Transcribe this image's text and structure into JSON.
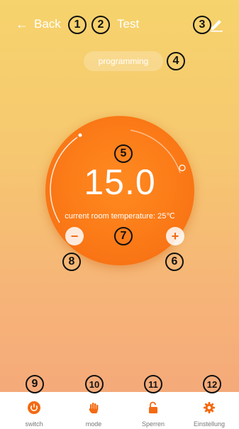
{
  "header": {
    "back_label": "Back",
    "title": "Test"
  },
  "mode_pill": "programming",
  "dial": {
    "setpoint": "15.0",
    "room_temp_text": "current room temperature:  25℃",
    "minus": "−",
    "plus": "+"
  },
  "tabs": [
    {
      "label": "switch",
      "icon": "power-icon"
    },
    {
      "label": "mode",
      "icon": "hand-icon"
    },
    {
      "label": "Sperren",
      "icon": "unlock-icon"
    },
    {
      "label": "Einstellung",
      "icon": "gear-icon"
    }
  ],
  "markers": [
    "1",
    "2",
    "3",
    "4",
    "5",
    "6",
    "7",
    "8",
    "9",
    "10",
    "11",
    "12"
  ],
  "colors": {
    "accent": "#f46a12",
    "bg_top": "#f6d36c",
    "bg_bottom": "#f4a67a"
  }
}
